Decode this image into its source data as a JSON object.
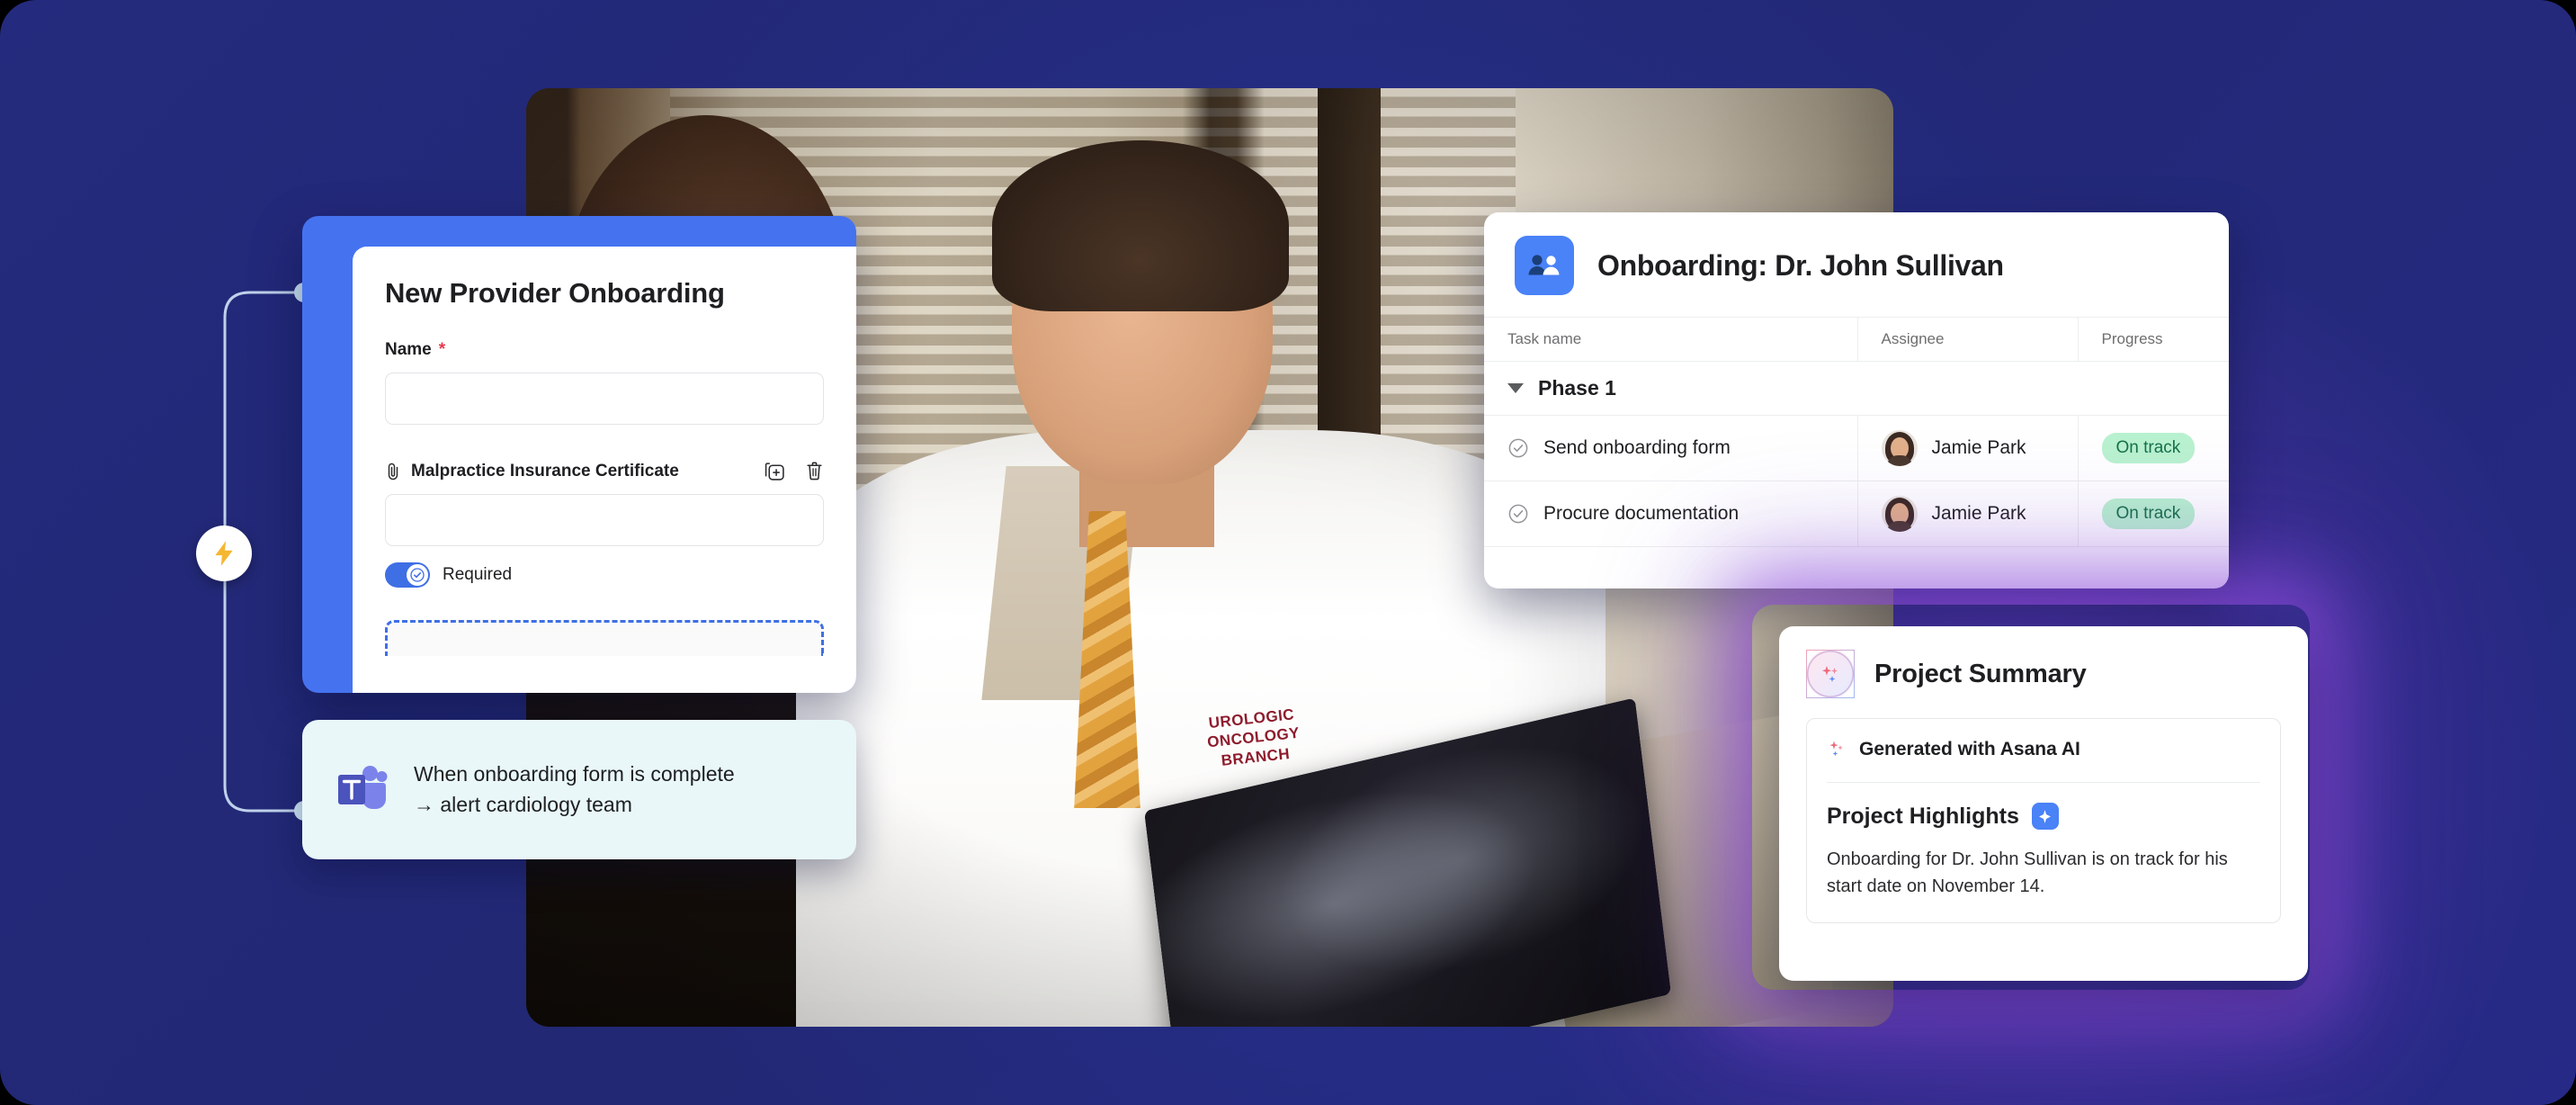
{
  "form_card": {
    "title": "New Provider Onboarding",
    "name_field": {
      "label": "Name",
      "required_marker": "*",
      "value": "",
      "placeholder": ""
    },
    "attachment_field": {
      "label": "Malpractice Insurance Certificate",
      "attach_icon": "paperclip-icon",
      "duplicate_icon": "duplicate-icon",
      "delete_icon": "trash-icon",
      "value": "",
      "placeholder": ""
    },
    "required_toggle": {
      "label": "Required",
      "state": "on"
    },
    "dropzone": {
      "label": ""
    },
    "header_color": "#4573f0",
    "accent_color": "#3f6fe4",
    "required_star_color": "#e8384f"
  },
  "teams_card": {
    "icon": "microsoft-teams-icon",
    "line1": "When onboarding form is complete",
    "line2": "→ alert cardiology team",
    "background": "#e9f7f9"
  },
  "automation": {
    "bolt_icon": "lightning-bolt-icon",
    "bolt_color": "#f5b731"
  },
  "task_card": {
    "header_icon": "people-icon",
    "header_icon_color": "#4a82f7",
    "title": "Onboarding: Dr. John Sullivan",
    "columns": [
      "Task name",
      "Assignee",
      "Progress"
    ],
    "groups": [
      {
        "name": "Phase 1",
        "expanded": true,
        "caret_icon": "caret-down-icon",
        "rows": [
          {
            "status_icon": "check-circle-icon",
            "task": "Send onboarding form",
            "assignee": "Jamie Park",
            "avatar": "avatar-jamie-park",
            "progress": "On track",
            "progress_bg": "#b9f2d0",
            "progress_fg": "#16714a"
          },
          {
            "status_icon": "check-circle-icon",
            "task": "Procure documentation",
            "assignee": "Jamie Park",
            "avatar": "avatar-jamie-park",
            "progress": "On track",
            "progress_bg": "#b9f2d0",
            "progress_fg": "#16714a"
          }
        ]
      }
    ]
  },
  "summary_card": {
    "badge_icon": "ai-sparkles-icon",
    "title": "Project Summary",
    "generated_icon": "sparkles-icon",
    "generated_label": "Generated with Asana AI",
    "highlights_title": "Project Highlights",
    "highlights_chip_icon": "sparkle-chip-icon",
    "highlights_text": "Onboarding for Dr. John Sullivan is on track for his start date on November 14.",
    "glow_color": "#9650e1"
  },
  "background": {
    "color": "#232877",
    "video_alt": "doctor-reviewing-xray-photo"
  }
}
